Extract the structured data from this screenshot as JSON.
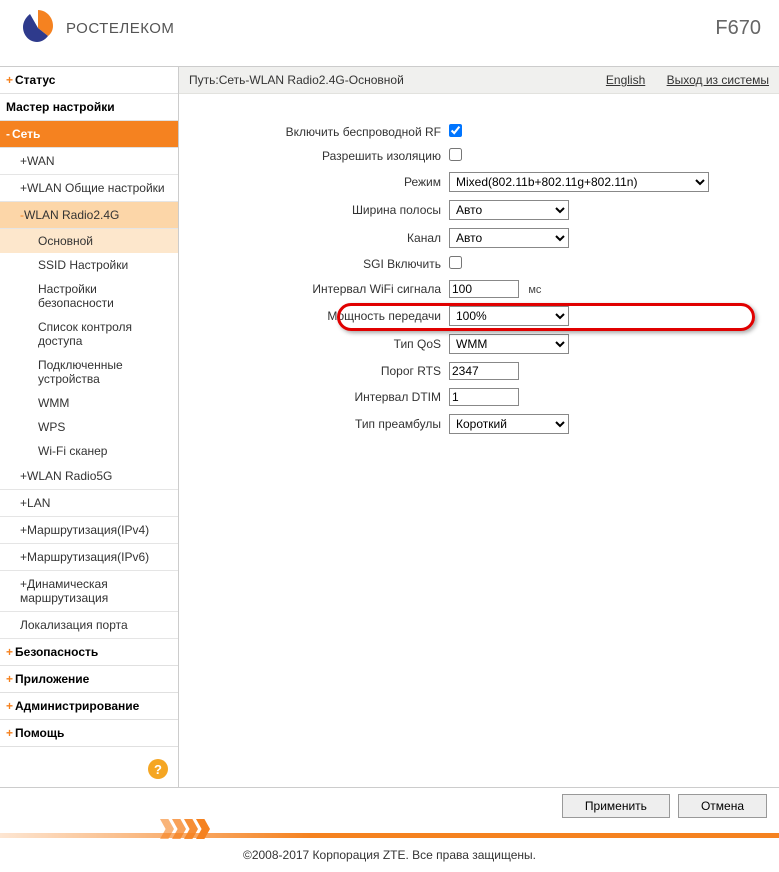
{
  "header": {
    "brand": "РОСТЕЛЕКОМ",
    "model": "F670"
  },
  "breadcrumb": {
    "path": "Путь:Сеть-WLAN Radio2.4G-Основной",
    "english": "English",
    "logout": "Выход из системы"
  },
  "sidebar": {
    "status": "Статус",
    "wizard": "Мастер настройки",
    "network": "Сеть",
    "wan": "WAN",
    "wlan_common": "WLAN Общие настройки",
    "wlan_24": "WLAN Radio2.4G",
    "sub": {
      "main": "Основной",
      "ssid": "SSID Настройки",
      "security": "Настройки безопасности",
      "acl": "Список контроля доступа",
      "devices": "Подключенные устройства",
      "wmm": "WMM",
      "wps": "WPS",
      "scanner": "Wi-Fi сканер"
    },
    "wlan_5": "WLAN Radio5G",
    "lan": "LAN",
    "routing4": "Маршрутизация(IPv4)",
    "routing6": "Маршрутизация(IPv6)",
    "dyn_routing": "Динамическая маршрутизация",
    "port_loc": "Локализация порта",
    "security_top": "Безопасность",
    "application": "Приложение",
    "admin": "Администрирование",
    "help": "Помощь"
  },
  "form": {
    "enable_rf": {
      "label": "Включить беспроводной RF",
      "checked": true
    },
    "isolation": {
      "label": "Разрешить изоляцию",
      "checked": false
    },
    "mode": {
      "label": "Режим",
      "value": "Mixed(802.11b+802.11g+802.11n)"
    },
    "bandwidth": {
      "label": "Ширина полосы",
      "value": "Авто"
    },
    "channel": {
      "label": "Канал",
      "value": "Авто"
    },
    "sgi": {
      "label": "SGI Включить",
      "checked": false
    },
    "beacon": {
      "label": "Интервал WiFi сигнала",
      "value": "100",
      "unit": "мс"
    },
    "txpower": {
      "label": "Мощность передачи",
      "value": "100%"
    },
    "qos": {
      "label": "Тип QoS",
      "value": "WMM"
    },
    "rts": {
      "label": "Порог RTS",
      "value": "2347"
    },
    "dtim": {
      "label": "Интервал DTIM",
      "value": "1"
    },
    "preamble": {
      "label": "Тип преамбулы",
      "value": "Короткий"
    }
  },
  "buttons": {
    "apply": "Применить",
    "cancel": "Отмена"
  },
  "copyright": "©2008-2017 Корпорация ZTE. Все права защищены."
}
